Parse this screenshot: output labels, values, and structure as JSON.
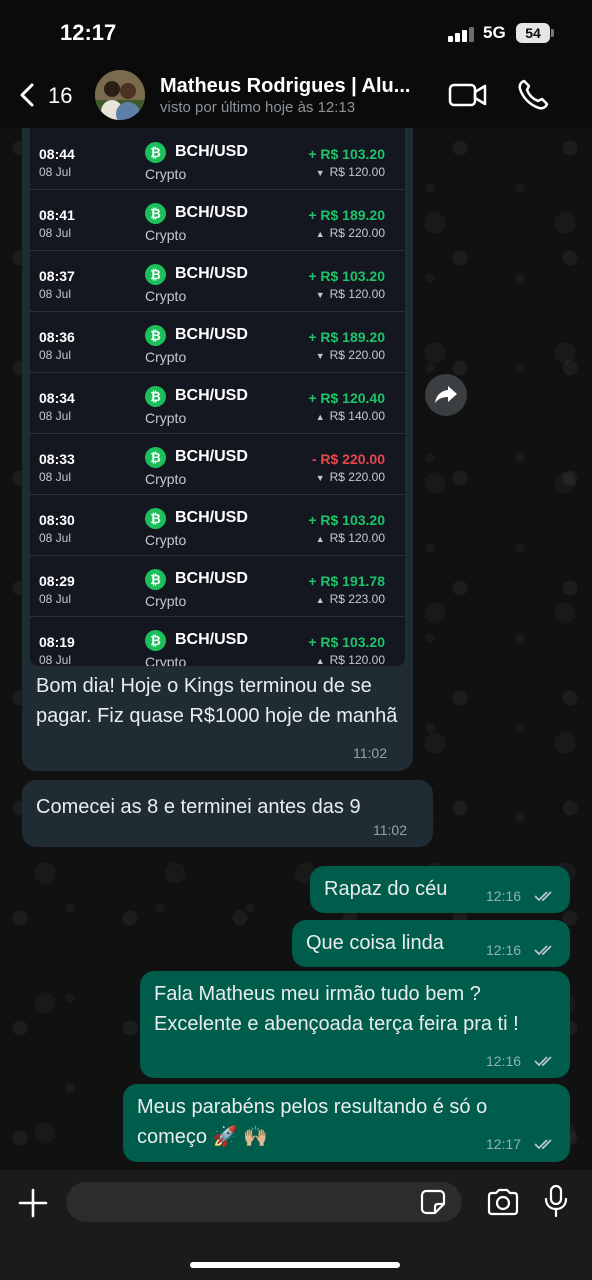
{
  "status_bar": {
    "time": "12:17",
    "network": "5G",
    "battery": "54"
  },
  "header": {
    "back_count": "16",
    "contact_name": "Matheus Rodrigues | Alu...",
    "last_seen": "visto por último hoje às 12:13",
    "icons": [
      "chevron-left-icon",
      "video-camera-icon",
      "phone-icon"
    ]
  },
  "trade_history": [
    {
      "time": "08:44",
      "date": "08 Jul",
      "pair": "BCH/USD",
      "type": "Crypto",
      "profit": "+ R$ 103.20",
      "direction": "down",
      "amount": "R$ 120.00"
    },
    {
      "time": "08:41",
      "date": "08 Jul",
      "pair": "BCH/USD",
      "type": "Crypto",
      "profit": "+ R$ 189.20",
      "direction": "up",
      "amount": "R$ 220.00"
    },
    {
      "time": "08:37",
      "date": "08 Jul",
      "pair": "BCH/USD",
      "type": "Crypto",
      "profit": "+ R$ 103.20",
      "direction": "down",
      "amount": "R$ 120.00"
    },
    {
      "time": "08:36",
      "date": "08 Jul",
      "pair": "BCH/USD",
      "type": "Crypto",
      "profit": "+ R$ 189.20",
      "direction": "down",
      "amount": "R$ 220.00"
    },
    {
      "time": "08:34",
      "date": "08 Jul",
      "pair": "BCH/USD",
      "type": "Crypto",
      "profit": "+ R$ 120.40",
      "direction": "up",
      "amount": "R$ 140.00"
    },
    {
      "time": "08:33",
      "date": "08 Jul",
      "pair": "BCH/USD",
      "type": "Crypto",
      "profit": "- R$ 220.00",
      "direction": "down",
      "amount": "R$ 220.00"
    },
    {
      "time": "08:30",
      "date": "08 Jul",
      "pair": "BCH/USD",
      "type": "Crypto",
      "profit": "+ R$ 103.20",
      "direction": "up",
      "amount": "R$ 120.00"
    },
    {
      "time": "08:29",
      "date": "08 Jul",
      "pair": "BCH/USD",
      "type": "Crypto",
      "profit": "+ R$ 191.78",
      "direction": "up",
      "amount": "R$ 223.00"
    },
    {
      "time": "08:19",
      "date": "08 Jul",
      "pair": "BCH/USD",
      "type": "Crypto",
      "profit": "+ R$ 103.20",
      "direction": "up",
      "amount": "R$ 120.00"
    }
  ],
  "messages": {
    "m1_text": "Bom dia! Hoje o Kings terminou de se pagar. Fiz quase R$1000 hoje de manhã",
    "m1_time": "11:02",
    "m2_text": "Comecei as 8 e terminei antes das 9",
    "m2_time": "11:02",
    "m3_text": "Rapaz do céu",
    "m3_time": "12:16",
    "m4_text": "Que coisa linda",
    "m4_time": "12:16",
    "m5_text": "Fala Matheus meu irmão tudo bem ? Excelente e abençoada terça feira pra ti !",
    "m5_time": "12:16",
    "m6_text": "Meus parabéns pelos resultando é só o começo 🚀 🙌🏼",
    "m6_time": "12:17"
  },
  "input": {
    "placeholder": "",
    "icons": [
      "plus-icon",
      "sticker-icon",
      "camera-icon",
      "microphone-icon"
    ]
  },
  "colors": {
    "incoming_bubble": "#1f2c33",
    "outgoing_bubble": "#005c4b",
    "profit_positive": "#1ec46b",
    "profit_negative": "#e5484d",
    "coin": "#1cbf5a"
  }
}
